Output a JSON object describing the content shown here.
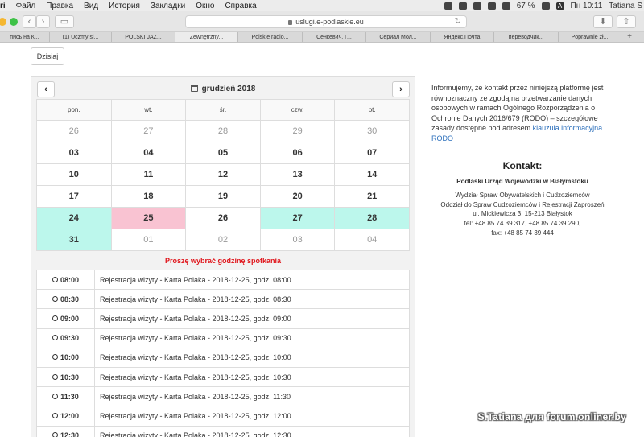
{
  "menubar": {
    "app": "ri",
    "items": [
      "Файл",
      "Правка",
      "Вид",
      "История",
      "Закладки",
      "Окно",
      "Справка"
    ],
    "battery": "67 %",
    "clock": "Пн 10:11",
    "user": "Tatiana S",
    "input_badge": "A"
  },
  "browser": {
    "url": "uslugi.e-podlaskie.eu",
    "tabs": [
      "пись на К...",
      "(1) Uczmy si...",
      "POLSKI JAZ...",
      "Zewnętrzny...",
      "Polskie radio...",
      "Сенкевич, Г...",
      "Сериал Мол...",
      "Яндекс.Почта",
      "переводчик...",
      "Poprawnie zł..."
    ],
    "active_tab": 3
  },
  "calendar": {
    "today_label": "Dzisiaj",
    "month_title": "grudzień 2018",
    "prev": "‹",
    "next": "›",
    "weekdays": [
      "pon.",
      "wt.",
      "śr.",
      "czw.",
      "pt."
    ],
    "weeks": [
      [
        {
          "d": "26",
          "s": "muted"
        },
        {
          "d": "27",
          "s": "muted"
        },
        {
          "d": "28",
          "s": "muted"
        },
        {
          "d": "29",
          "s": "muted"
        },
        {
          "d": "30",
          "s": "muted"
        }
      ],
      [
        {
          "d": "03",
          "s": ""
        },
        {
          "d": "04",
          "s": ""
        },
        {
          "d": "05",
          "s": ""
        },
        {
          "d": "06",
          "s": ""
        },
        {
          "d": "07",
          "s": ""
        }
      ],
      [
        {
          "d": "10",
          "s": ""
        },
        {
          "d": "11",
          "s": ""
        },
        {
          "d": "12",
          "s": ""
        },
        {
          "d": "13",
          "s": ""
        },
        {
          "d": "14",
          "s": ""
        }
      ],
      [
        {
          "d": "17",
          "s": ""
        },
        {
          "d": "18",
          "s": ""
        },
        {
          "d": "19",
          "s": ""
        },
        {
          "d": "20",
          "s": ""
        },
        {
          "d": "21",
          "s": ""
        }
      ],
      [
        {
          "d": "24",
          "s": "avail"
        },
        {
          "d": "25",
          "s": "selected"
        },
        {
          "d": "26",
          "s": ""
        },
        {
          "d": "27",
          "s": "avail"
        },
        {
          "d": "28",
          "s": "avail"
        }
      ],
      [
        {
          "d": "31",
          "s": "avail"
        },
        {
          "d": "01",
          "s": "muted"
        },
        {
          "d": "02",
          "s": "muted"
        },
        {
          "d": "03",
          "s": "muted"
        },
        {
          "d": "04",
          "s": "muted"
        }
      ]
    ],
    "pick_time_label": "Proszę wybrać godzinę spotkania",
    "slots": [
      {
        "time": "08:00",
        "desc": "Rejestracja wizyty - Karta Polaka - 2018-12-25, godz. 08:00"
      },
      {
        "time": "08:30",
        "desc": "Rejestracja wizyty - Karta Polaka - 2018-12-25, godz. 08:30"
      },
      {
        "time": "09:00",
        "desc": "Rejestracja wizyty - Karta Polaka - 2018-12-25, godz. 09:00"
      },
      {
        "time": "09:30",
        "desc": "Rejestracja wizyty - Karta Polaka - 2018-12-25, godz. 09:30"
      },
      {
        "time": "10:00",
        "desc": "Rejestracja wizyty - Karta Polaka - 2018-12-25, godz. 10:00"
      },
      {
        "time": "10:30",
        "desc": "Rejestracja wizyty - Karta Polaka - 2018-12-25, godz. 10:30"
      },
      {
        "time": "11:30",
        "desc": "Rejestracja wizyty - Karta Polaka - 2018-12-25, godz. 11:30"
      },
      {
        "time": "12:00",
        "desc": "Rejestracja wizyty - Karta Polaka - 2018-12-25, godz. 12:00"
      },
      {
        "time": "12:30",
        "desc": "Rejestracja wizyty - Karta Polaka - 2018-12-25, godz. 12:30"
      }
    ]
  },
  "info": {
    "text": "Informujemy, że kontakt przez niniejszą platformę jest równoznaczny ze zgodą na przetwarzanie danych osobowych w ramach Ogólnego Rozporządzenia o Ochronie Danych 2016/679 (RODO) – szczegółowe zasady dostępne pod adresem",
    "link": "klauzula informacyjna RODO"
  },
  "contact": {
    "title": "Kontakt:",
    "org": "Podlaski Urząd Wojewódzki w Białymstoku",
    "dept": "Wydział Spraw Obywatelskich i Cudzoziemców",
    "office": "Oddział do Spraw Cudzoziemców i Rejestracji Zaproszeń",
    "address": "ul. Mickiewicza 3, 15-213 Białystok",
    "tel": "tel: +48 85 74 39 317, +48 85 74 39 290,",
    "fax": "fax: +48 85 74 39 444"
  },
  "watermark": "S.Tatiana для forum.onliner.by",
  "colors": {
    "available": "#bcf7ec",
    "selected": "#f9c3d2",
    "alert": "#e0151b",
    "link": "#2a6ebb"
  }
}
